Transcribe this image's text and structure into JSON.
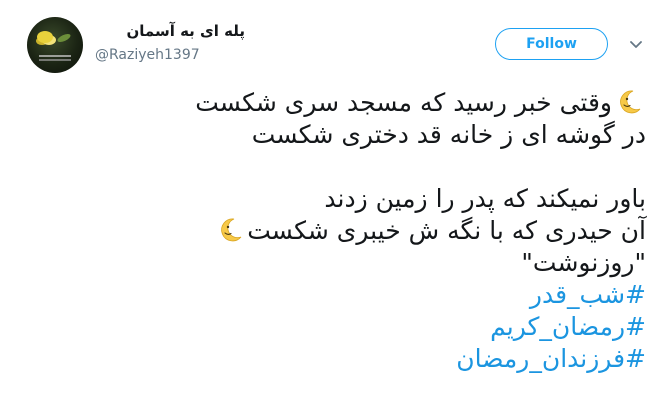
{
  "header": {
    "display_name": "پله ای به آسمان",
    "username": "@Raziyeh1397",
    "follow_label": "Follow"
  },
  "tweet": {
    "line1": "وقتی خبر رسید که مسجد سری شکست",
    "line2": "در گوشه ای ز خانه قد دختری شکست",
    "line3": "باور نمیکند که پدر را زمین زدند",
    "line4": "آن حیدری که با نگه ش خیبری شکست",
    "line5": "\"روزنوشت\"",
    "hashtags": [
      "#شب_قدر",
      "#رمضان_کریم",
      "#فرزندان_رمضان"
    ]
  },
  "icons": {
    "moon": "crescent-moon-face-icon",
    "caret": "chevron-down-icon"
  },
  "colors": {
    "accent": "#1da1f2",
    "link": "#1b95e0",
    "text": "#14171a",
    "muted": "#657786"
  }
}
